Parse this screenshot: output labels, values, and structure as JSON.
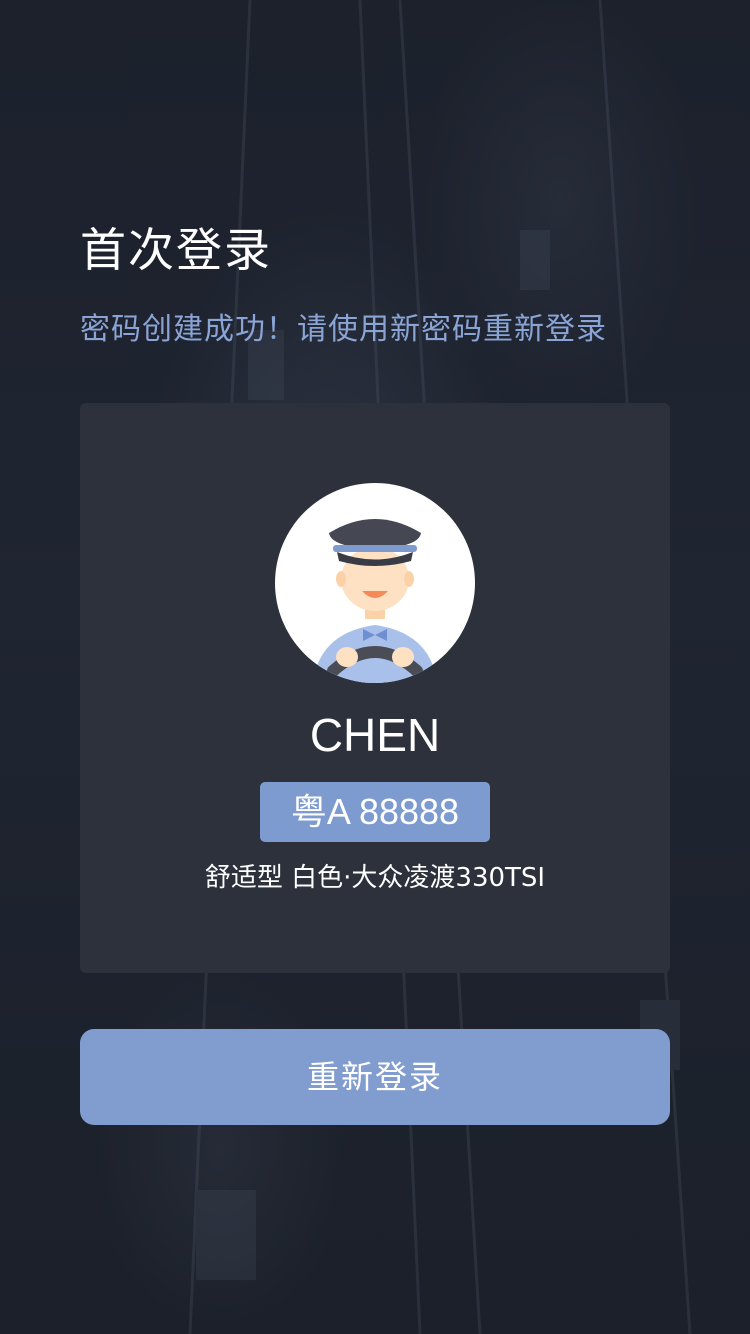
{
  "page": {
    "title": "首次登录",
    "subtitle": "密码创建成功！请使用新密码重新登录"
  },
  "driver_card": {
    "avatar_icon": "driver-avatar-icon",
    "name": "CHEN",
    "plate": "粤A 88888",
    "car_info": "舒适型 白色·大众凌渡330TSI"
  },
  "actions": {
    "relogin_label": "重新登录"
  },
  "colors": {
    "background": "#1c212c",
    "card": "#2c313c",
    "accent": "#819ccf",
    "subtitle": "#8aa4d6"
  }
}
